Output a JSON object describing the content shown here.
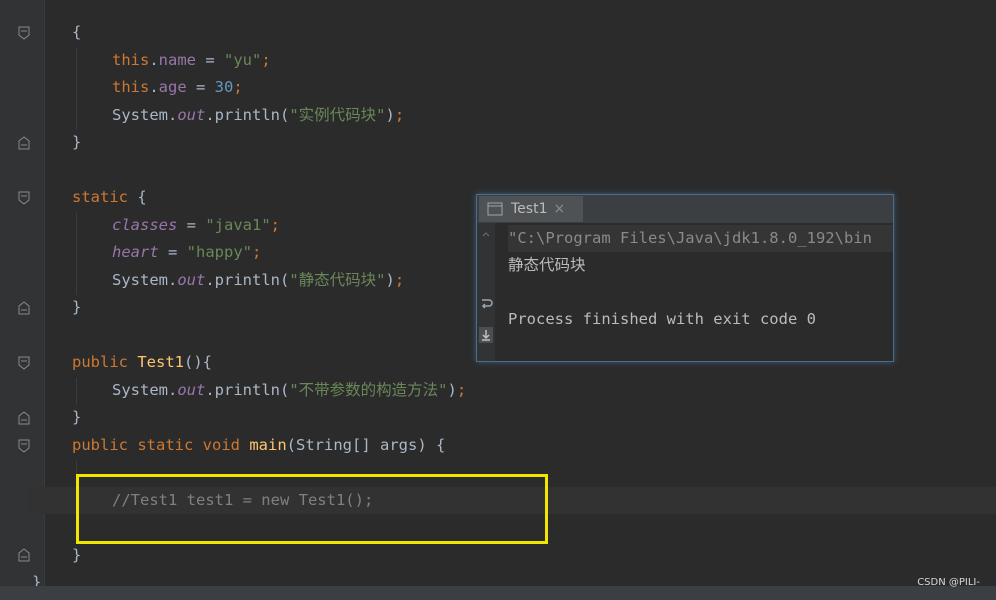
{
  "code": {
    "l1": "{",
    "l2": {
      "kw": "this",
      "dot": ".",
      "fld": "name",
      "eq": " = ",
      "str": "\"yu\"",
      "semi": ";"
    },
    "l3": {
      "kw": "this",
      "dot": ".",
      "fld": "age",
      "eq": " = ",
      "num": "30",
      "semi": ";"
    },
    "l4": {
      "cls": "System.",
      "out": "out",
      "call": ".println(",
      "str": "\"实例代码块\"",
      "close": ")",
      "semi": ";"
    },
    "l5": "}",
    "l6": {
      "kw": "static",
      "rest": " {"
    },
    "l7": {
      "sfld": "classes",
      "eq": " = ",
      "str": "\"java1\"",
      "semi": ";"
    },
    "l8": {
      "sfld": "heart",
      "eq": " = ",
      "str": "\"happy\"",
      "semi": ";"
    },
    "l9": {
      "cls": "System.",
      "out": "out",
      "call": ".println(",
      "str": "\"静态代码块\"",
      "close": ")",
      "semi": ";"
    },
    "l10": "}",
    "l11": {
      "kw": "public",
      "sp": " ",
      "fn": "Test1",
      "rest": "(){"
    },
    "l12": {
      "cls": "System.",
      "out": "out",
      "call": ".println(",
      "str": "\"不带参数的构造方法\"",
      "close": ")",
      "semi": ";"
    },
    "l13": "}",
    "l14": {
      "kw1": "public",
      "kw2": " static",
      "kw3": " void",
      "sp": " ",
      "fn": "main",
      "rest": "(String[] args) {"
    },
    "l15": "//Test1 test1 = new Test1();",
    "l16": "}",
    "l17": "}"
  },
  "run_panel": {
    "tab_label": "Test1",
    "tab_close": "×",
    "cmd": "\"C:\\Program Files\\Java\\jdk1.8.0_192\\bin",
    "output1": "静态代码块",
    "output2": "",
    "output3": "Process finished with exit code 0"
  },
  "watermark": "CSDN @PILI-",
  "colors": {
    "highlight": "#f2e600",
    "keyword": "#cc7832",
    "string": "#6a8759"
  }
}
